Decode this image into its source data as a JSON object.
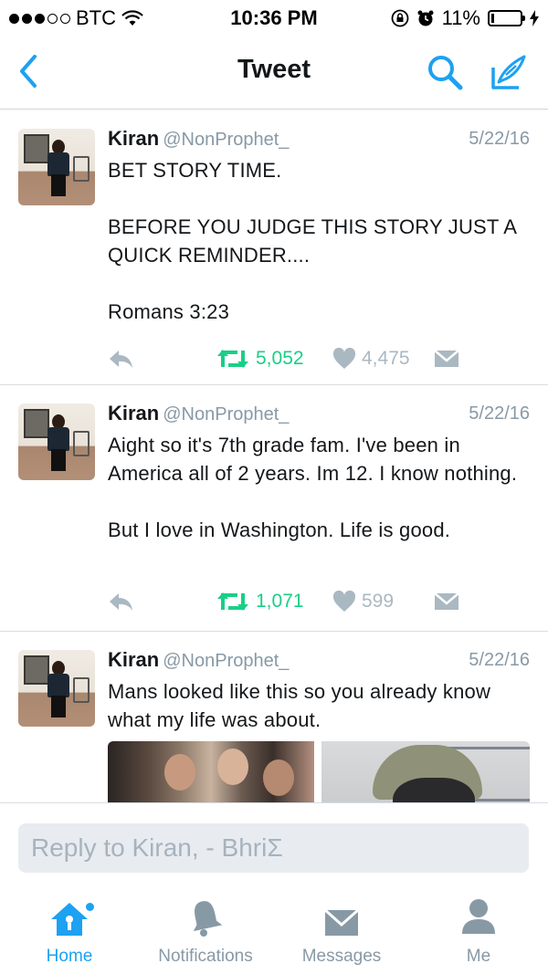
{
  "status_bar": {
    "carrier": "BTC",
    "time": "10:36 PM",
    "battery": "11%",
    "battery_level": 0.11
  },
  "nav": {
    "title": "Tweet",
    "back_icon": "chevron-left-icon",
    "search_icon": "search-icon",
    "compose_icon": "compose-icon"
  },
  "tweets": [
    {
      "name": "Kiran",
      "handle": "@NonProphet_",
      "date": "5/22/16",
      "text": "BET STORY TIME.\n\nBEFORE YOU JUDGE THIS STORY JUST A QUICK REMINDER....\n\nRomans 3:23",
      "retweets": "5,052",
      "likes": "4,475"
    },
    {
      "name": "Kiran",
      "handle": "@NonProphet_",
      "date": "5/22/16",
      "text": "Aight so it's 7th grade fam. I've been in America all of 2 years. Im 12. I know nothing.\n\nBut I love in Washington. Life is good.",
      "retweets": "1,071",
      "likes": "599"
    },
    {
      "name": "Kiran",
      "handle": "@NonProphet_",
      "date": "5/22/16",
      "text": "Mans looked like this so you already know what my life was about."
    }
  ],
  "reply": {
    "placeholder": "Reply to Kiran, - BhriΣ"
  },
  "tabs": [
    {
      "label": "Home",
      "icon": "home-icon",
      "active": true
    },
    {
      "label": "Notifications",
      "icon": "bell-icon"
    },
    {
      "label": "Messages",
      "icon": "envelope-icon"
    },
    {
      "label": "Me",
      "icon": "person-icon"
    }
  ],
  "colors": {
    "accent": "#1da1f2",
    "retweet": "#19cf86",
    "muted": "#8899a6",
    "like": "#aab8c2"
  }
}
